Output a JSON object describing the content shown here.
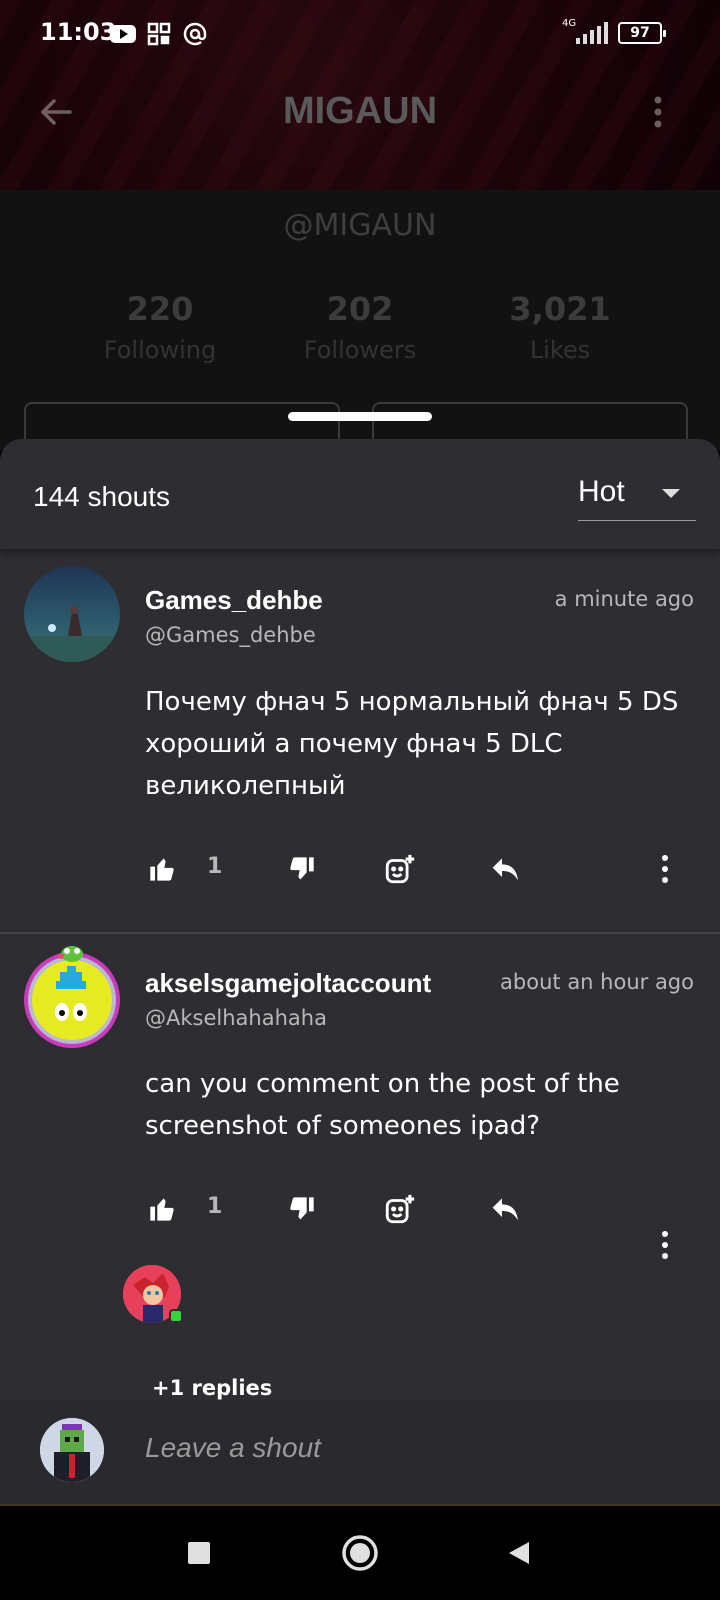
{
  "status_bar": {
    "time": "11:03",
    "network": "4G",
    "battery": "97",
    "icons": [
      "youtube-icon",
      "qr-icon",
      "at-icon",
      "signal-icon",
      "battery-icon"
    ]
  },
  "profile": {
    "title": "MIGAUN",
    "handle": "@MIGAUN",
    "stats": [
      {
        "value": "220",
        "label": "Following"
      },
      {
        "value": "202",
        "label": "Followers"
      },
      {
        "value": "3,021",
        "label": "Likes"
      }
    ]
  },
  "sheet": {
    "shout_count": "144 shouts",
    "sort_value": "Hot"
  },
  "comments": [
    {
      "name": "Games_dehbe",
      "handle": "@Games_dehbe",
      "time": "a minute ago",
      "body": "Почему фнач 5 нормальный фнач 5 DS хороший а почему фнач 5 DLC великолепный",
      "likes": "1"
    },
    {
      "name": "akselsgamejoltaccount",
      "handle": "@Akselhahahaha",
      "time": "about an hour ago",
      "body": "can you comment on the post of  the screenshot of someones ipad?",
      "likes": "1",
      "replies": "+1 replies"
    }
  ],
  "composer": {
    "placeholder": "Leave a shout"
  },
  "colors": {
    "sheet_bg": "#2e2d31",
    "online": "#35d43a"
  }
}
